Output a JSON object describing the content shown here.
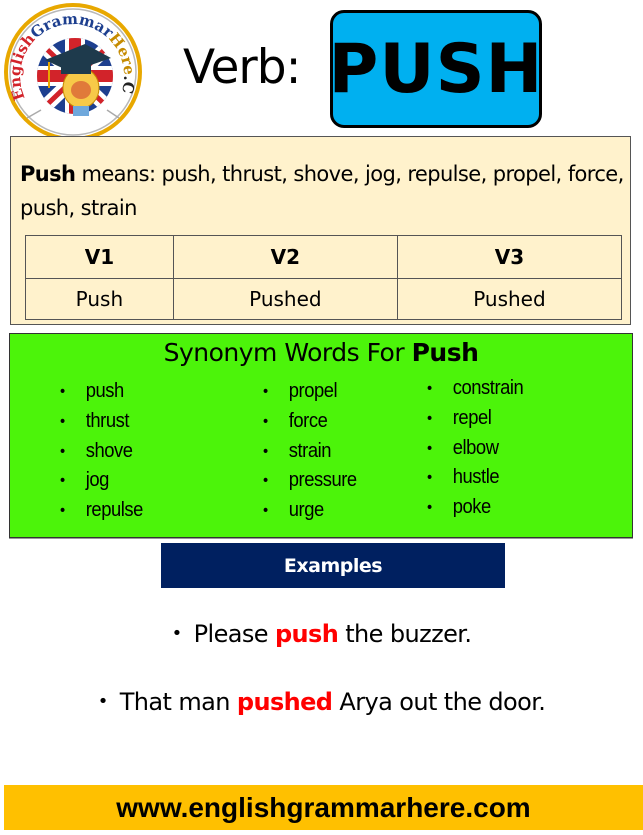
{
  "logo": {
    "text_red": "English",
    "text_blue": "Grammar",
    "text_gold": "Here",
    "text_dark": ".Com"
  },
  "header": {
    "label": "Verb:",
    "verb": "PUSH",
    "verb_box_color": "#00b0f0"
  },
  "meaning": {
    "word": "Push",
    "rest": " means: push, thrust, shove, jog, repulse, propel, force, push, strain",
    "background": "#fff2cc"
  },
  "forms": {
    "headers": [
      "V1",
      "V2",
      "V3"
    ],
    "values": [
      "Push",
      "Pushed",
      "Pushed"
    ]
  },
  "synonyms": {
    "title_prefix": "Synonym Words For ",
    "title_word": "Push",
    "background": "#4cf40a",
    "columns": [
      [
        "push",
        "thrust",
        "shove",
        "jog",
        "repulse"
      ],
      [
        "propel",
        "force",
        "strain",
        "pressure",
        "urge"
      ],
      [
        "constrain",
        "repel",
        "elbow",
        "hustle",
        "poke"
      ]
    ]
  },
  "examples": {
    "label": "Examples",
    "bar_color": "#002060",
    "highlight_color": "#ff0000",
    "sentences": [
      {
        "before": "Please ",
        "highlight": "push",
        "after": " the buzzer."
      },
      {
        "before": "That man ",
        "highlight": "pushed",
        "after": " Arya out the door."
      }
    ]
  },
  "footer": {
    "url": "www.englishgrammarhere.com",
    "background": "#ffc000"
  }
}
